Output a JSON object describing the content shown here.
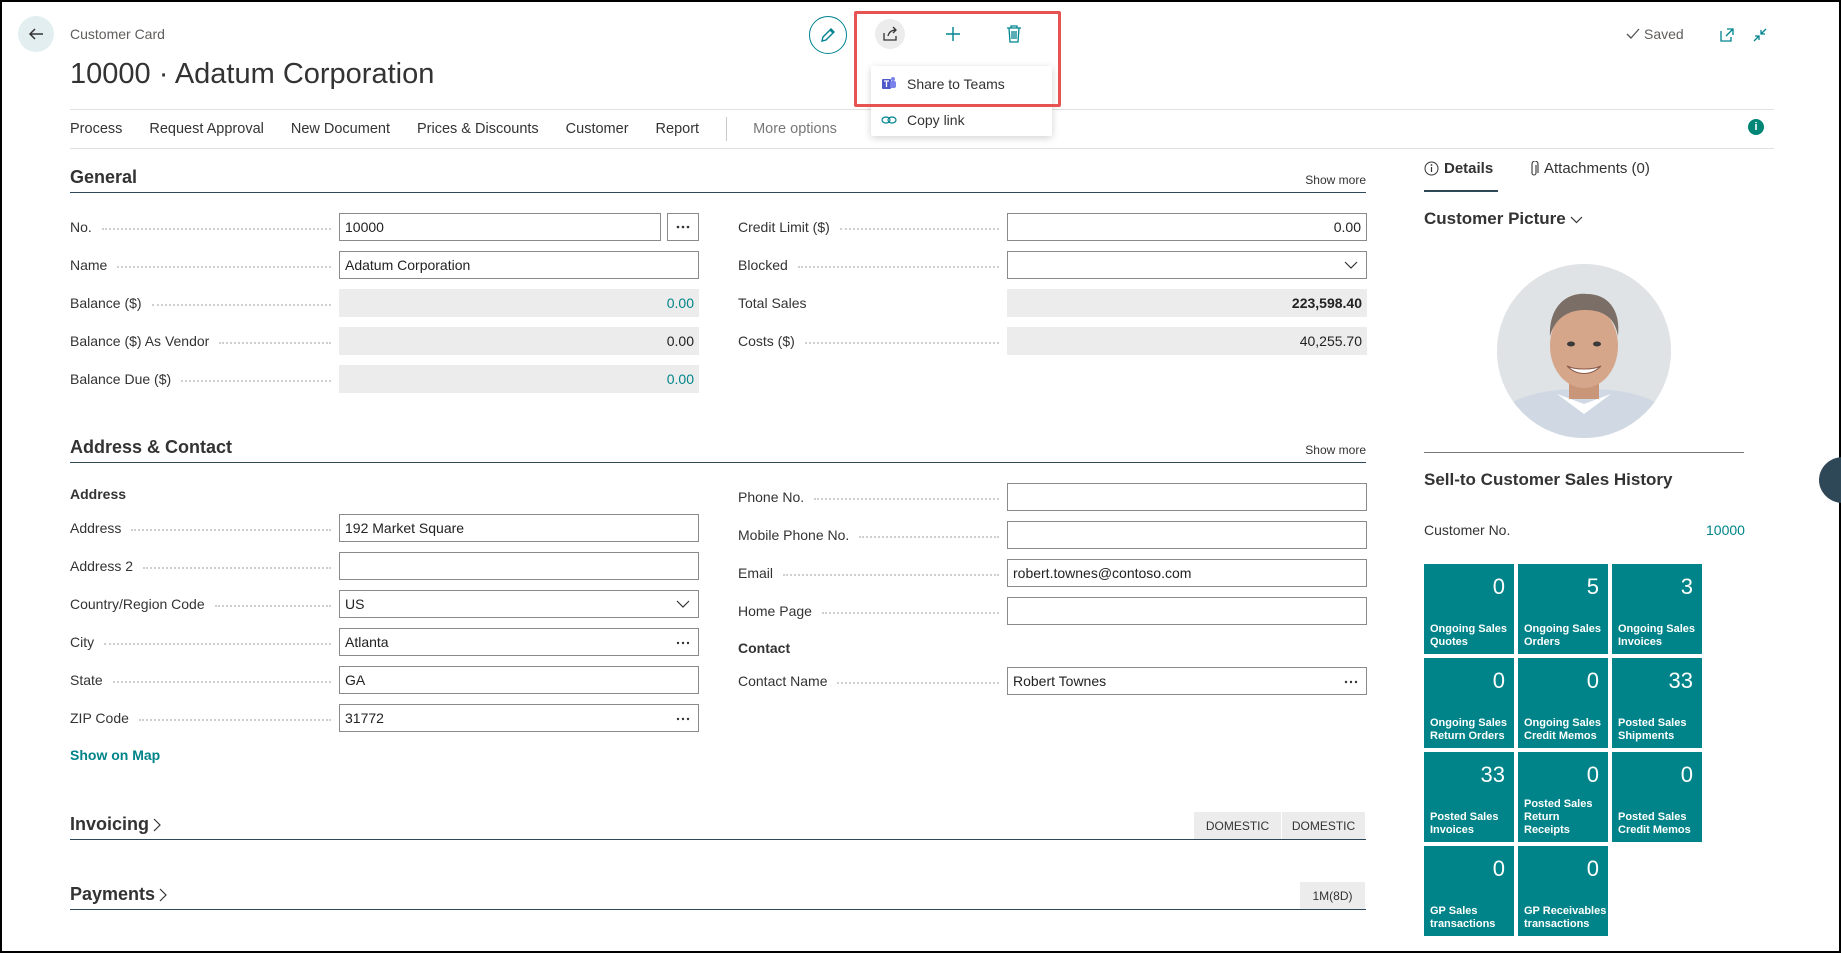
{
  "header": {
    "caption": "Customer Card",
    "title": "10000 · Adatum Corporation",
    "saved": "Saved"
  },
  "share_menu": {
    "items": [
      {
        "label": "Share to Teams",
        "icon": "teams-icon"
      },
      {
        "label": "Copy link",
        "icon": "link-icon"
      }
    ]
  },
  "actions": [
    "Process",
    "Request Approval",
    "New Document",
    "Prices & Discounts",
    "Customer",
    "Report"
  ],
  "more_options": "More options",
  "general": {
    "title": "General",
    "show_more": "Show more",
    "left": [
      {
        "label": "No.",
        "value": "10000"
      },
      {
        "label": "Name",
        "value": "Adatum Corporation"
      },
      {
        "label": "Balance ($)",
        "value": "0.00"
      },
      {
        "label": "Balance ($) As Vendor",
        "value": "0.00"
      },
      {
        "label": "Balance Due ($)",
        "value": "0.00"
      }
    ],
    "right": [
      {
        "label": "Credit Limit ($)",
        "value": "0.00"
      },
      {
        "label": "Blocked",
        "value": ""
      },
      {
        "label": "Total Sales",
        "value": "223,598.40"
      },
      {
        "label": "Costs ($)",
        "value": "40,255.70"
      }
    ]
  },
  "address": {
    "title": "Address & Contact",
    "show_more": "Show more",
    "sub_address": "Address",
    "sub_contact": "Contact",
    "left": [
      {
        "label": "Address",
        "value": "192 Market Square"
      },
      {
        "label": "Address 2",
        "value": ""
      },
      {
        "label": "Country/Region Code",
        "value": "US"
      },
      {
        "label": "City",
        "value": "Atlanta"
      },
      {
        "label": "State",
        "value": "GA"
      },
      {
        "label": "ZIP Code",
        "value": "31772"
      }
    ],
    "right": [
      {
        "label": "Phone No.",
        "value": ""
      },
      {
        "label": "Mobile Phone No.",
        "value": ""
      },
      {
        "label": "Email",
        "value": "robert.townes@contoso.com"
      },
      {
        "label": "Home Page",
        "value": ""
      },
      {
        "label": "Contact Name",
        "value": "Robert Townes"
      }
    ],
    "show_on_map": "Show on Map"
  },
  "invoicing": {
    "title": "Invoicing",
    "tags": [
      "DOMESTIC",
      "DOMESTIC"
    ]
  },
  "payments": {
    "title": "Payments",
    "tags": [
      "1M(8D)"
    ]
  },
  "factbox": {
    "tabs": [
      "Details",
      "Attachments (0)"
    ],
    "picture_title": "Customer Picture",
    "history_title": "Sell-to Customer Sales History",
    "customer_no_label": "Customer No.",
    "customer_no_value": "10000",
    "tiles": [
      {
        "value": "0",
        "label": "Ongoing Sales Quotes"
      },
      {
        "value": "5",
        "label": "Ongoing Sales Orders"
      },
      {
        "value": "3",
        "label": "Ongoing Sales Invoices"
      },
      {
        "value": "0",
        "label": "Ongoing Sales Return Orders"
      },
      {
        "value": "0",
        "label": "Ongoing Sales Credit Memos"
      },
      {
        "value": "33",
        "label": "Posted Sales Shipments"
      },
      {
        "value": "33",
        "label": "Posted Sales Invoices"
      },
      {
        "value": "0",
        "label": "Posted Sales Return Receipts"
      },
      {
        "value": "0",
        "label": "Posted Sales Credit Memos"
      },
      {
        "value": "0",
        "label": "GP Sales transactions"
      },
      {
        "value": "0",
        "label": "GP Receivables transactions"
      }
    ]
  },
  "colors": {
    "accent": "#008489",
    "highlight": "#e55353",
    "section_rule": "#2f4858"
  }
}
